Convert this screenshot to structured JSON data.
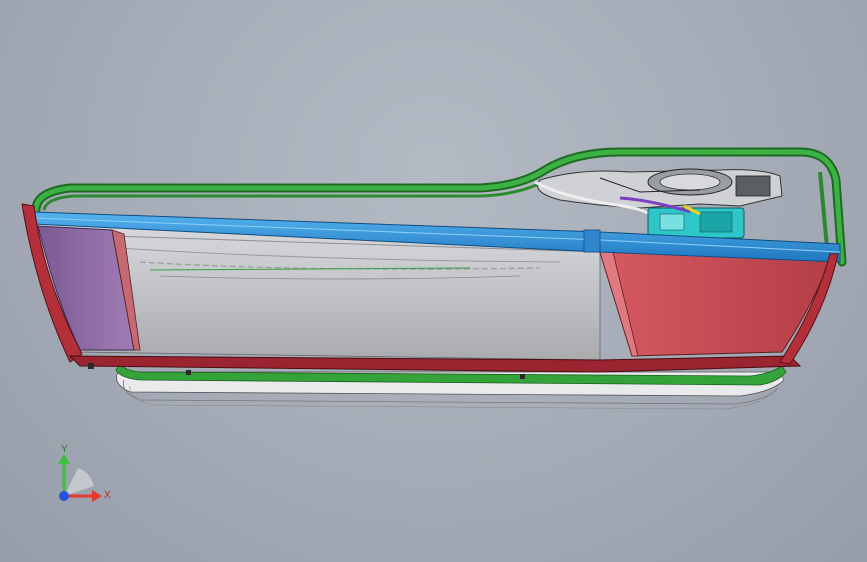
{
  "triad": {
    "y_label": "Y",
    "x_label": "X"
  },
  "colors": {
    "frame_green": "#2f9a2f",
    "rail_blue": "#2d8fd6",
    "panel_red": "#c74a52",
    "panel_purple": "#8e6aa6",
    "glass": "#c8c9cc",
    "edge_dark_red": "#7a1820",
    "mechanism_cyan": "#2ec7c9",
    "axis_y": "#3fbf3f",
    "axis_x": "#e33a2d",
    "axis_z": "#2a4fe0"
  }
}
